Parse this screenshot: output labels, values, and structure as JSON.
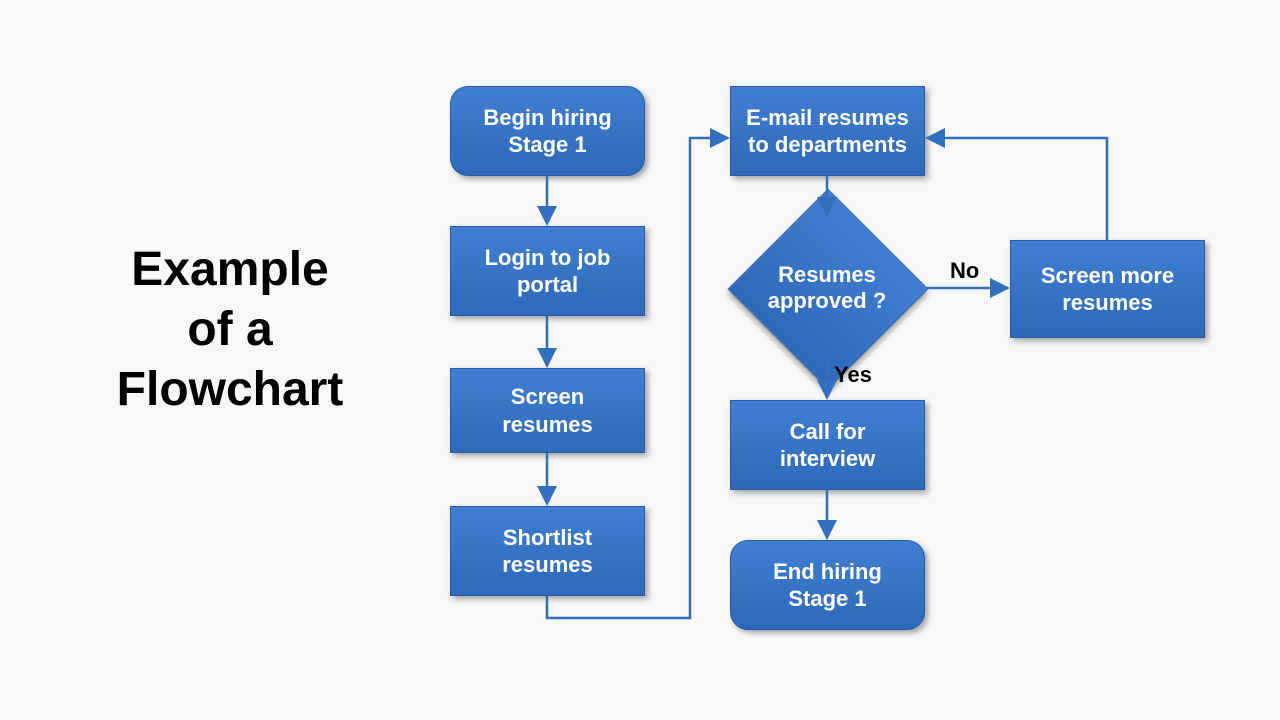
{
  "title_lines": [
    "Example",
    "of a",
    "Flowchart"
  ],
  "nodes": {
    "begin": {
      "label": "Begin hiring Stage 1"
    },
    "login": {
      "label": "Login to job portal"
    },
    "screen": {
      "label": "Screen resumes"
    },
    "shortlist": {
      "label": "Shortlist resumes"
    },
    "email": {
      "label": "E-mail resumes to departments"
    },
    "approved": {
      "label": "Resumes approved ?"
    },
    "call": {
      "label": "Call for interview"
    },
    "end": {
      "label": "End hiring Stage 1"
    },
    "more": {
      "label": "Screen more resumes"
    }
  },
  "decision_labels": {
    "yes": "Yes",
    "no": "No"
  },
  "colors": {
    "node_fill": "#336fbf",
    "edge": "#336fbf"
  }
}
